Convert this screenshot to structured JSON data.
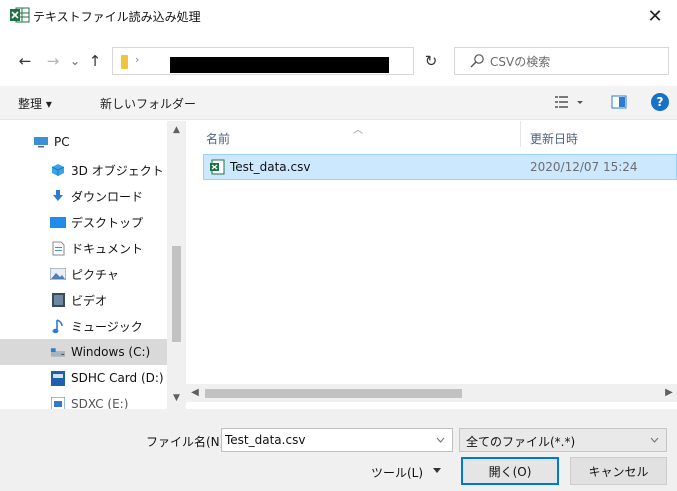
{
  "window": {
    "title": "テキストファイル読み込み処理",
    "close_glyph": "✕",
    "app_icon": "excel-icon"
  },
  "address_bar": {
    "back_glyph": "←",
    "forward_glyph": "→",
    "recent_glyph": "⌄",
    "up_glyph": "↑",
    "separator_glyph": "›",
    "refresh_glyph": "↻",
    "path_redacted": true
  },
  "search": {
    "placeholder": "CSVの検索"
  },
  "toolbar": {
    "organize_label": "整理 ▾",
    "new_folder_label": "新しいフォルダー",
    "help_label": "?"
  },
  "nav": {
    "items": [
      {
        "label": "PC",
        "icon": "pc-icon"
      },
      {
        "label": "3D オブジェクト",
        "icon": "3d-objects-icon"
      },
      {
        "label": "ダウンロード",
        "icon": "download-icon"
      },
      {
        "label": "デスクトップ",
        "icon": "desktop-icon"
      },
      {
        "label": "ドキュメント",
        "icon": "documents-icon"
      },
      {
        "label": "ピクチャ",
        "icon": "pictures-icon"
      },
      {
        "label": "ビデオ",
        "icon": "video-icon"
      },
      {
        "label": "ミュージック",
        "icon": "music-icon"
      },
      {
        "label": "Windows (C:)",
        "icon": "drive-icon"
      },
      {
        "label": "SDHC Card (D:)",
        "icon": "sd-card-icon"
      },
      {
        "label": "SDXC (E:)",
        "icon": "sd-card-icon"
      }
    ],
    "selected_index": 8
  },
  "file_list": {
    "column_name": "名前",
    "column_date": "更新日時",
    "rows": [
      {
        "name": "Test_data.csv",
        "date": "2020/12/07 15:24",
        "icon": "csv-file-icon"
      }
    ]
  },
  "footer": {
    "filename_label": "ファイル名(N):",
    "filename_value": "Test_data.csv",
    "filter_value": "全てのファイル(*.*)",
    "tools_label": "ツール(L)",
    "open_label": "開く(O)",
    "cancel_label": "キャンセル"
  },
  "colors": {
    "accent": "#0078d7",
    "selection": "#cce8ff",
    "excel_green": "#1e7145"
  }
}
